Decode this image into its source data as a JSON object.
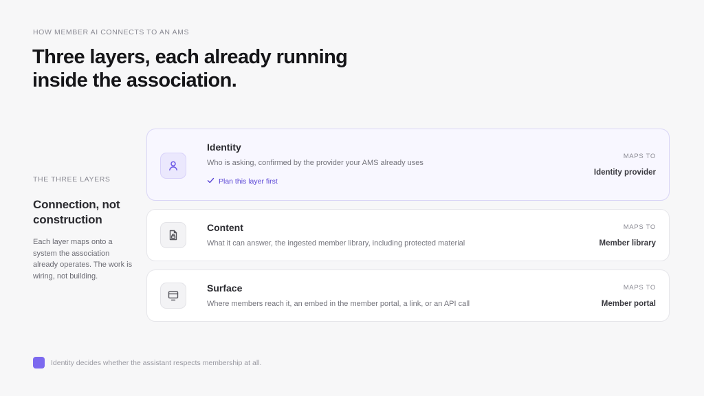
{
  "header": {
    "eyebrow": "HOW MEMBER AI CONNECTS TO AN AMS",
    "headline": "Three layers, each already running inside the association."
  },
  "sidebar": {
    "label": "THE THREE LAYERS",
    "title": "Connection, not construction",
    "body": "Each layer maps onto a system the association already operates. The work is wiring, not building."
  },
  "layers": [
    {
      "title": "Identity",
      "description": "Who is asking, confirmed by the provider your AMS already uses",
      "flag": "Plan this layer first",
      "maps_label": "MAPS TO",
      "maps_value": "Identity provider",
      "icon": "user-icon",
      "active": true
    },
    {
      "title": "Content",
      "description": "What it can answer, the ingested member library, including protected material",
      "maps_label": "MAPS TO",
      "maps_value": "Member library",
      "icon": "locked-document-icon",
      "active": false
    },
    {
      "title": "Surface",
      "description": "Where members reach it, an embed in the member portal, a link, or an API call",
      "maps_label": "MAPS TO",
      "maps_value": "Member portal",
      "icon": "monitor-icon",
      "active": false
    }
  ],
  "footer": {
    "note": "Identity decides whether the assistant respects membership at all."
  },
  "colors": {
    "accent": "#7c69ef",
    "accent_text": "#5b47d6",
    "active_card_bg": "#f8f7ff",
    "active_card_border": "#d9d5f6",
    "background": "#f7f7f8"
  }
}
